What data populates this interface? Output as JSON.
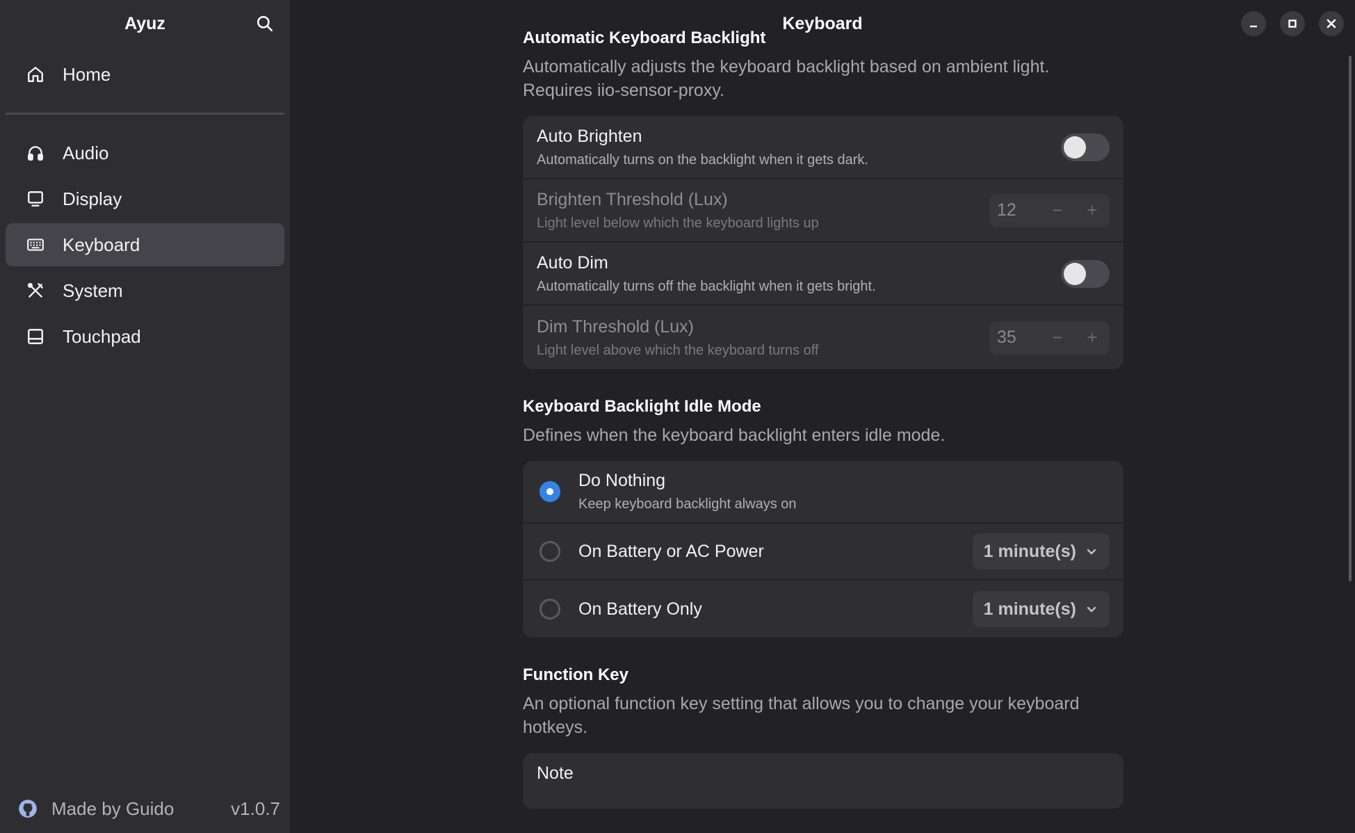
{
  "app": {
    "title": "Ayuz",
    "page_title": "Keyboard"
  },
  "sidebar": {
    "items": [
      {
        "label": "Home",
        "icon": "home-icon"
      },
      {
        "label": "Audio",
        "icon": "headphones-icon"
      },
      {
        "label": "Display",
        "icon": "monitor-icon"
      },
      {
        "label": "Keyboard",
        "icon": "keyboard-icon",
        "active": true
      },
      {
        "label": "System",
        "icon": "tools-icon"
      },
      {
        "label": "Touchpad",
        "icon": "touchpad-icon"
      }
    ],
    "footer": {
      "made_by": "Made by Guido",
      "version": "v1.0.7",
      "icon": "github-icon"
    }
  },
  "auto_backlight": {
    "title": "Automatic Keyboard Backlight",
    "description": "Automatically adjusts the keyboard backlight based on ambient light. Requires iio-sensor-proxy.",
    "auto_brighten": {
      "title": "Auto Brighten",
      "subtitle": "Automatically turns on the backlight when it gets dark.",
      "enabled": false
    },
    "brighten_threshold": {
      "title": "Brighten Threshold (Lux)",
      "subtitle": "Light level below which the keyboard lights up",
      "value": "12",
      "minus": "−",
      "plus": "+"
    },
    "auto_dim": {
      "title": "Auto Dim",
      "subtitle": "Automatically turns off the backlight when it gets bright.",
      "enabled": false
    },
    "dim_threshold": {
      "title": "Dim Threshold (Lux)",
      "subtitle": "Light level above which the keyboard turns off",
      "value": "35",
      "minus": "−",
      "plus": "+"
    }
  },
  "idle_mode": {
    "title": "Keyboard Backlight Idle Mode",
    "description": "Defines when the keyboard backlight enters idle mode.",
    "options": [
      {
        "title": "Do Nothing",
        "subtitle": "Keep keyboard backlight always on",
        "selected": true
      },
      {
        "title": "On Battery or AC Power",
        "dropdown": "1 minute(s)",
        "selected": false
      },
      {
        "title": "On Battery Only",
        "dropdown": "1 minute(s)",
        "selected": false
      }
    ]
  },
  "function_key": {
    "title": "Function Key",
    "description": "An optional function key setting that allows you to change your keyboard hotkeys.",
    "note_title": "Note"
  },
  "colors": {
    "accent": "#3584e4",
    "sidebar_bg": "#2e2e32",
    "main_bg": "#222226",
    "card_bg": "#2f2f33"
  }
}
